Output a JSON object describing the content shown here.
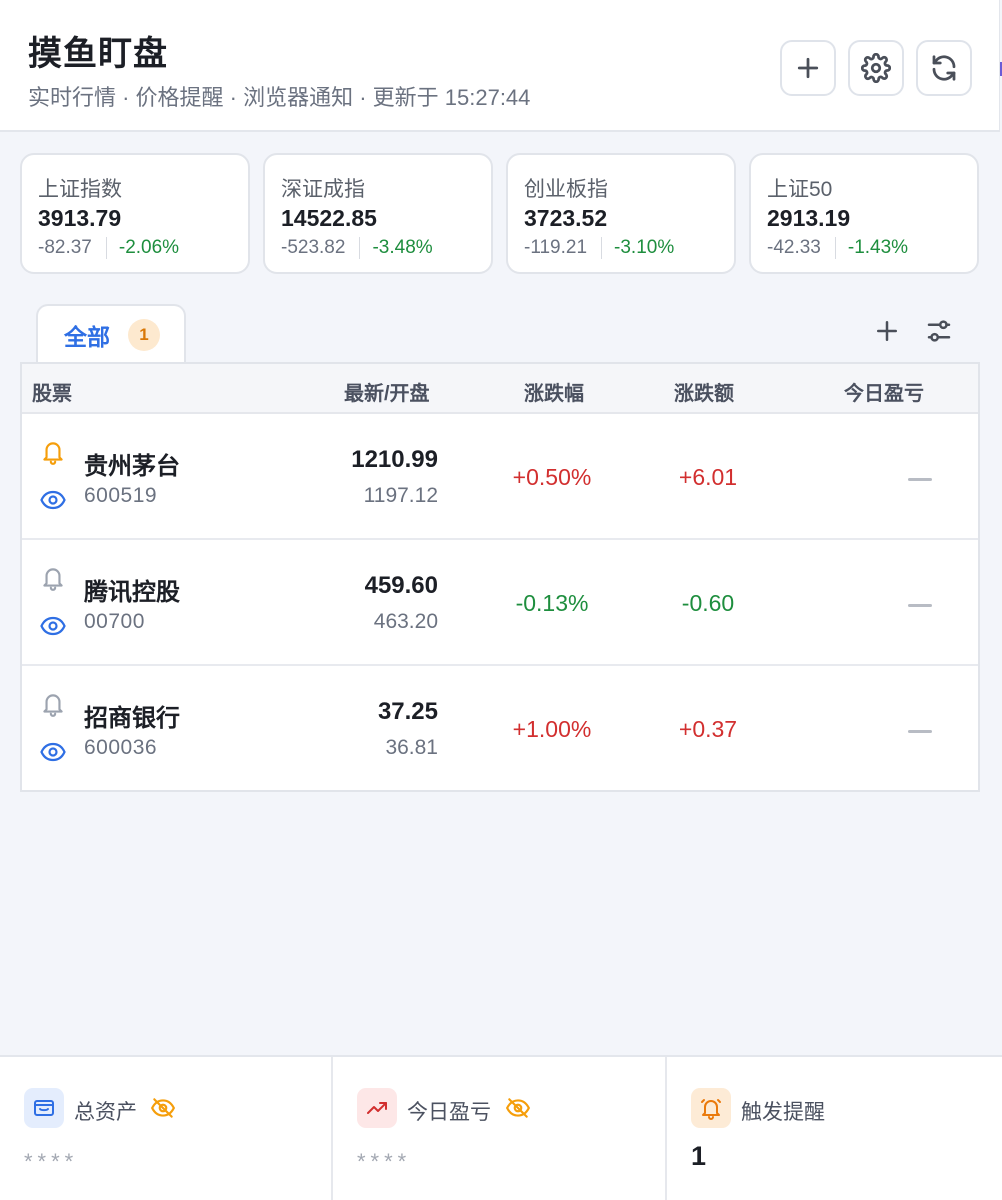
{
  "header": {
    "title": "摸鱼盯盘",
    "subtitle": "实时行情 · 价格提醒 · 浏览器通知 · 更新于 15:27:44"
  },
  "indices": [
    {
      "name": "上证指数",
      "value": "3913.79",
      "change": "-82.37",
      "pct": "-2.06%"
    },
    {
      "name": "深证成指",
      "value": "14522.85",
      "change": "-523.82",
      "pct": "-3.48%"
    },
    {
      "name": "创业板指",
      "value": "3723.52",
      "change": "-119.21",
      "pct": "-3.10%"
    },
    {
      "name": "上证50",
      "value": "2913.19",
      "change": "-42.33",
      "pct": "-1.43%"
    }
  ],
  "tabs": [
    {
      "label": "全部",
      "badge": "1"
    }
  ],
  "table": {
    "headers": [
      "股票",
      "最新/开盘",
      "涨跌幅",
      "涨跌额",
      "今日盈亏"
    ],
    "rows": [
      {
        "name": "贵州茅台",
        "code": "600519",
        "price": "1210.99",
        "open": "1197.12",
        "pct": "+0.50%",
        "amount": "+6.01",
        "pnl": "—",
        "alert_active": true,
        "direction": "up"
      },
      {
        "name": "腾讯控股",
        "code": "00700",
        "price": "459.60",
        "open": "463.20",
        "pct": "-0.13%",
        "amount": "-0.60",
        "pnl": "—",
        "alert_active": false,
        "direction": "down"
      },
      {
        "name": "招商银行",
        "code": "600036",
        "price": "37.25",
        "open": "36.81",
        "pct": "+1.00%",
        "amount": "+0.37",
        "pnl": "—",
        "alert_active": false,
        "direction": "up"
      }
    ]
  },
  "footer": {
    "total_assets": {
      "label": "总资产",
      "value": "****"
    },
    "today_pnl": {
      "label": "今日盈亏",
      "value": "****"
    },
    "alerts": {
      "label": "触发提醒",
      "value": "1"
    }
  },
  "colors": {
    "up": "#d22f2f",
    "down": "#1e8e3e",
    "accent": "#2f6fe4",
    "alert": "#f59e0b"
  }
}
